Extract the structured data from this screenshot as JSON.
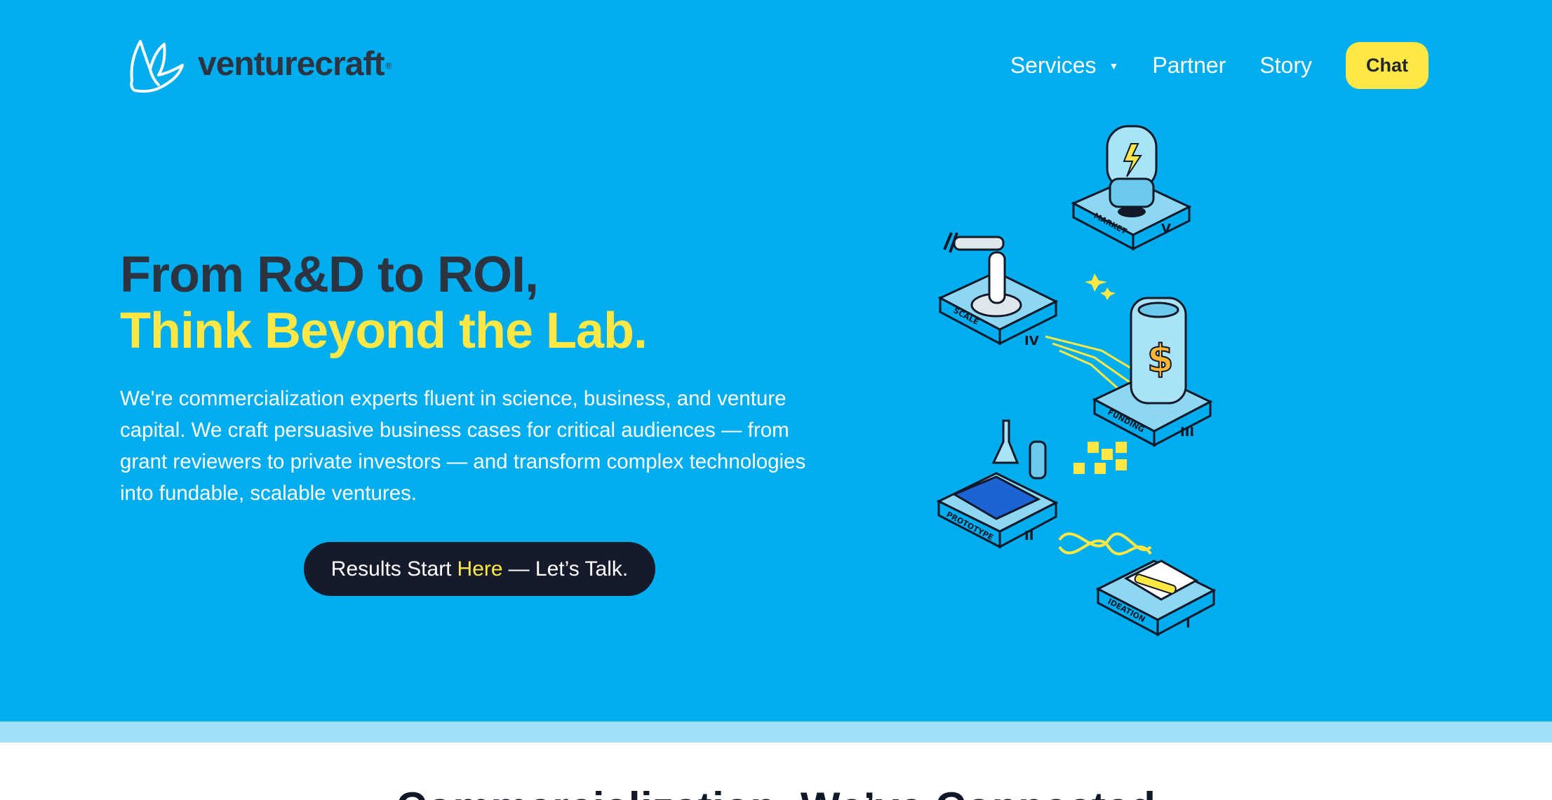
{
  "header": {
    "logo_text": "venturecraft",
    "logo_reg": "®",
    "nav": [
      {
        "label": "Services",
        "has_dropdown": true
      },
      {
        "label": "Partner"
      },
      {
        "label": "Story"
      }
    ],
    "chat_label": "Chat"
  },
  "hero": {
    "headline_line1": "From R&D to ROI,",
    "headline_line2": "Think Beyond the Lab.",
    "lead": "We're commercialization experts fluent in science, business, and venture capital. We craft persuasive business cases for critical audiences — from grant reviewers to private investors — and transform complex technologies into fundable, scalable ventures.",
    "cta": {
      "part1": "Results Start",
      "highlight": "Here",
      "part2": "— Let’s Talk."
    },
    "platforms": [
      {
        "label": "MARKET",
        "numeral": "V"
      },
      {
        "label": "SCALE",
        "numeral": "IV"
      },
      {
        "label": "FUNDING",
        "numeral": "III"
      },
      {
        "label": "PROTOTYPE",
        "numeral": "II"
      },
      {
        "label": "IDEATION",
        "numeral": "I"
      }
    ]
  },
  "below": {
    "heading": "Commercialization, We’ve Connected"
  },
  "colors": {
    "hero_bg": "#00adee",
    "accent_yellow": "#ffe845",
    "dark_text": "#2b3440",
    "cta_bg": "#161b2c"
  }
}
